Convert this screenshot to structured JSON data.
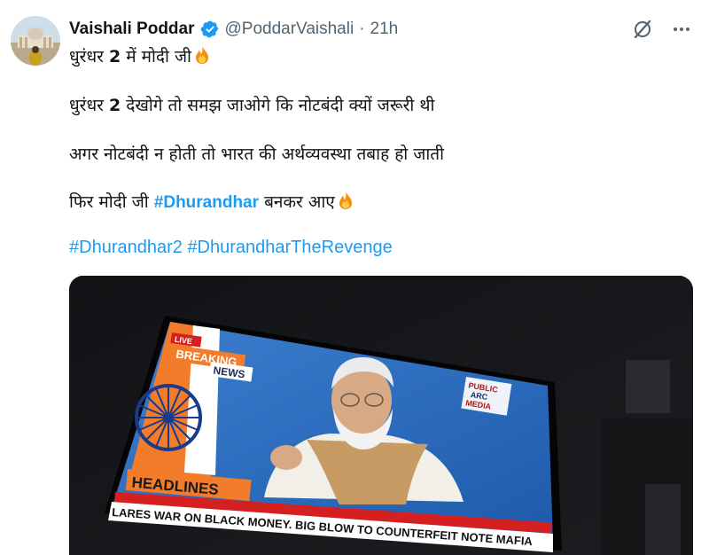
{
  "author": {
    "name": "Vaishali Poddar",
    "handle": "@PoddarVaishali",
    "separator": "·",
    "time": "21h"
  },
  "tweet": {
    "line1_text": "धुरंधर ",
    "line1_num": "2",
    "line1_tail": " में मोदी जी",
    "line2_text": "धुरंधर ",
    "line2_num": "2",
    "line2_tail": " देखोगे तो समझ जाओगे कि नोटबंदी क्यों जरूरी थी",
    "line3": "अगर नोटबंदी न होती तो भारत की अर्थव्यवस्था तबाह हो जाती",
    "line4_pre": "फिर मोदी जी ",
    "line4_tag": "#Dhurandhar",
    "line4_post": " बनकर आए",
    "hashtag1": "#Dhurandhar2",
    "hashtag2": "#DhurandharTheRevenge"
  },
  "media": {
    "tv_live": "LIVE",
    "tv_breaking": "BREAKING",
    "tv_news": "NEWS",
    "tv_channel_1": "PUBLIC",
    "tv_channel_2": "ARC",
    "tv_channel_3": "MEDIA",
    "tv_headlines": "HEADLINES",
    "tv_ticker": "LARES WAR ON BLACK MONEY.  BIG BLOW TO COUNTERFEIT NOTE MAFIA"
  },
  "colors": {
    "link": "#1d9bf0",
    "text": "#0f1419",
    "muted": "#536471",
    "verified": "#1d9bf0"
  },
  "icons": [
    "verified-badge-icon",
    "grok-slash-icon",
    "more-icon",
    "fire-emoji-icon"
  ]
}
